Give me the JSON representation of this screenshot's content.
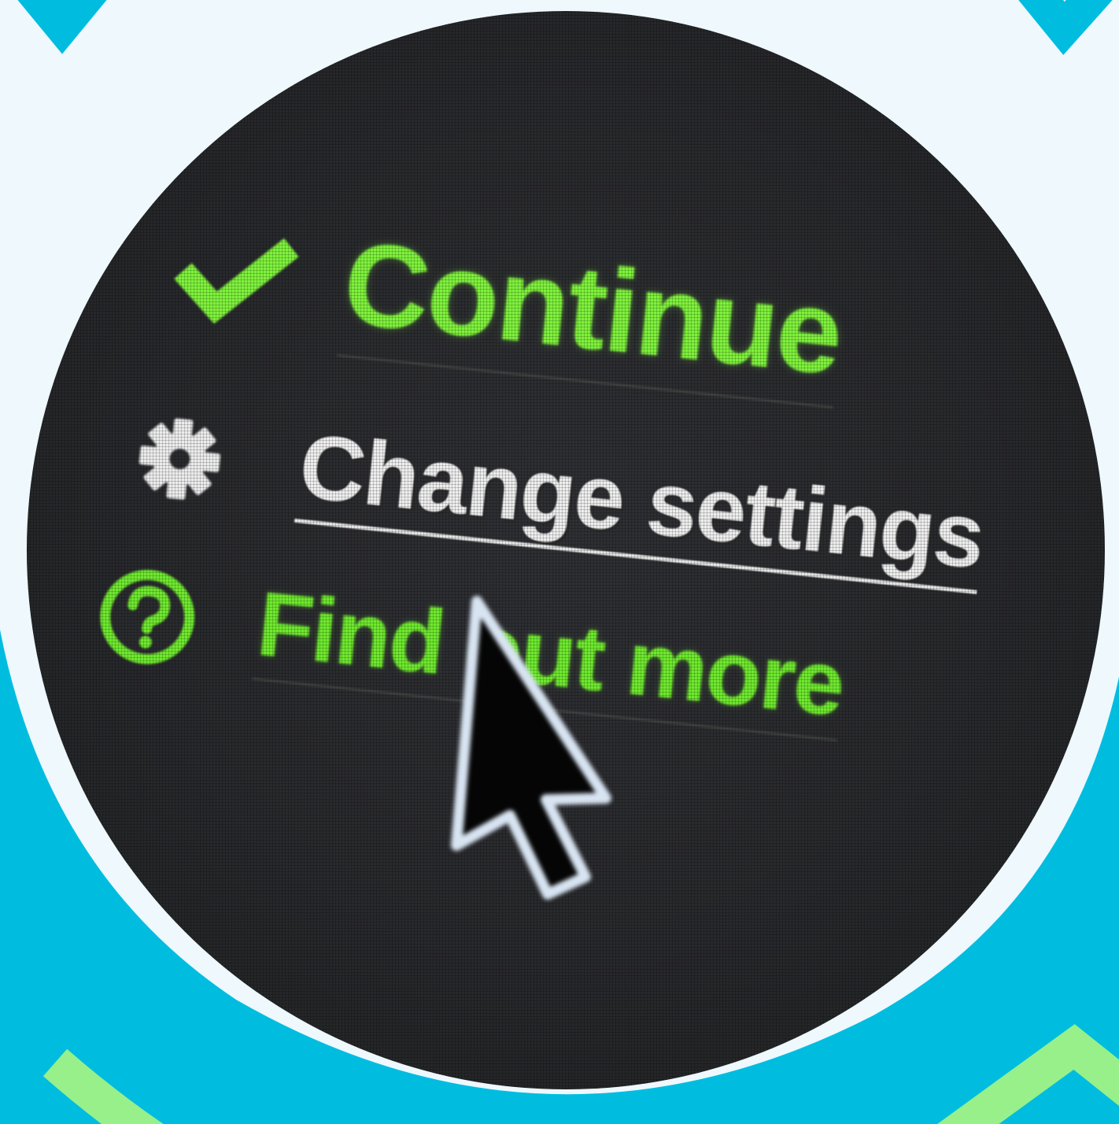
{
  "menu": {
    "items": [
      {
        "label": "Continue",
        "icon": "checkmark-icon",
        "color": "#7ff23c"
      },
      {
        "label": "Change settings",
        "icon": "gear-icon",
        "color": "#eeeeee"
      },
      {
        "label": "Find out more",
        "icon": "help-icon",
        "color": "#6fea2e"
      }
    ]
  },
  "pointer": {
    "icon": "mouse-pointer-icon"
  },
  "colors": {
    "background": "#eef8fd",
    "accent_blue": "#00bde0",
    "accent_green": "#98f08a",
    "screen": "#2a2b2e"
  }
}
